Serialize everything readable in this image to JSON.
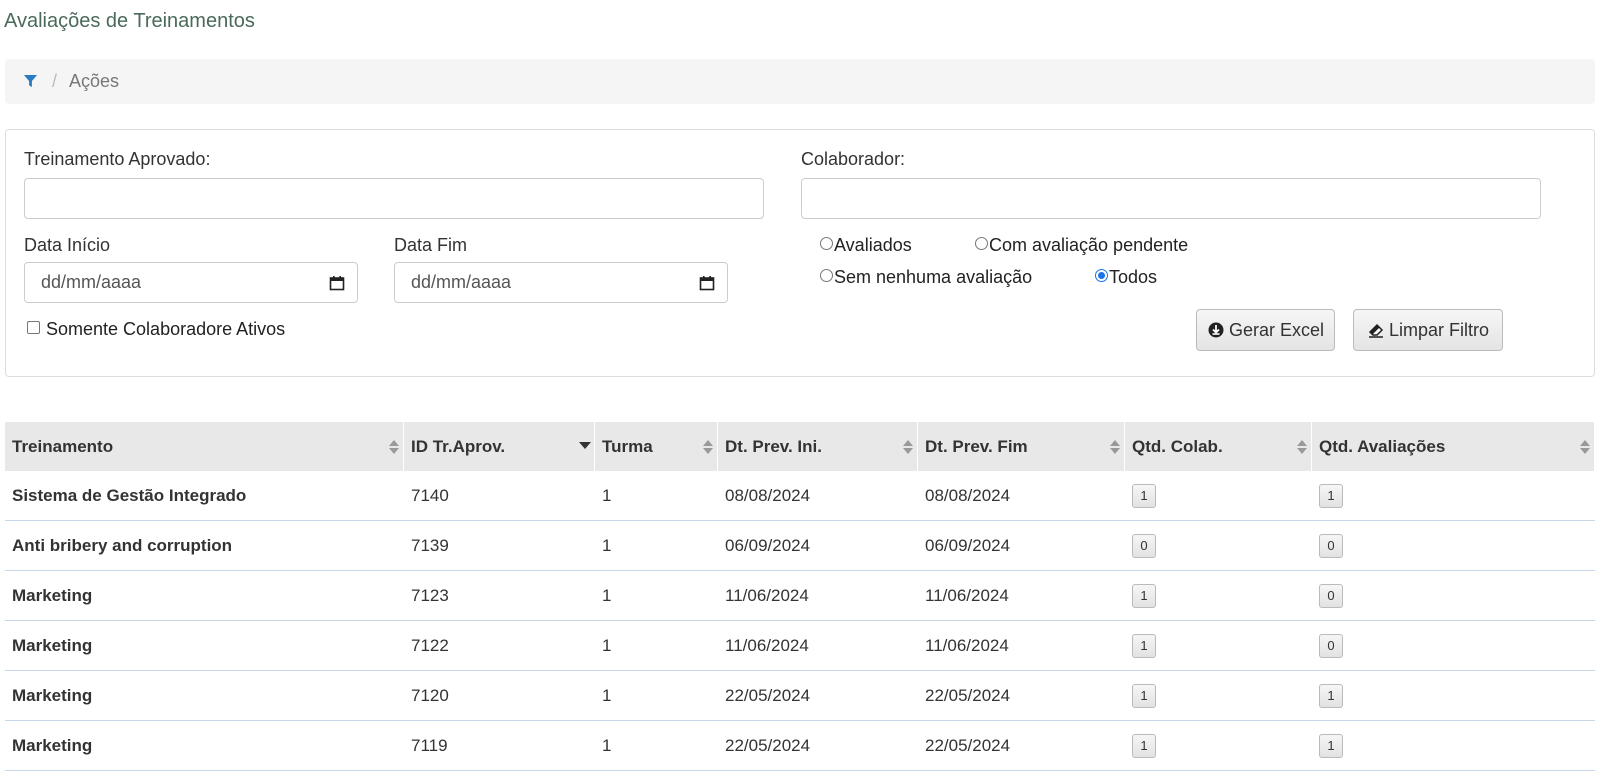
{
  "title": "Avaliações de Treinamentos",
  "breadcrumb": {
    "icon": "filter-icon",
    "separator": "/",
    "label": "Ações"
  },
  "filters": {
    "treinamento_label": "Treinamento Aprovado:",
    "treinamento_value": "",
    "colaborador_label": "Colaborador:",
    "colaborador_value": "",
    "data_inicio_label": "Data Início",
    "data_inicio_placeholder": "dd/mm/aaaa",
    "data_fim_label": "Data Fim",
    "data_fim_placeholder": "dd/mm/aaaa",
    "radios": [
      {
        "label": "Avaliados",
        "checked": false
      },
      {
        "label": "Com avaliação pendente",
        "checked": false
      },
      {
        "label": "Sem nenhuma avaliação",
        "checked": false
      },
      {
        "label": "Todos",
        "checked": true
      }
    ],
    "checkbox_label": "Somente Colaboradore Ativos",
    "checkbox_checked": false,
    "btn_excel": "Gerar Excel",
    "btn_limpar": "Limpar Filtro"
  },
  "table": {
    "columns": [
      "Treinamento",
      "ID Tr.Aprov.",
      "Turma",
      "Dt. Prev. Ini.",
      "Dt. Prev. Fim",
      "Qtd. Colab.",
      "Qtd. Avaliações"
    ],
    "sorted_column": "ID Tr.Aprov.",
    "rows": [
      {
        "treinamento": "Sistema de Gestão Integrado",
        "id": "7140",
        "turma": "1",
        "ini": "08/08/2024",
        "fim": "08/08/2024",
        "colab": "1",
        "aval": "1"
      },
      {
        "treinamento": "Anti bribery and corruption",
        "id": "7139",
        "turma": "1",
        "ini": "06/09/2024",
        "fim": "06/09/2024",
        "colab": "0",
        "aval": "0"
      },
      {
        "treinamento": "Marketing",
        "id": "7123",
        "turma": "1",
        "ini": "11/06/2024",
        "fim": "11/06/2024",
        "colab": "1",
        "aval": "0"
      },
      {
        "treinamento": "Marketing",
        "id": "7122",
        "turma": "1",
        "ini": "11/06/2024",
        "fim": "11/06/2024",
        "colab": "1",
        "aval": "0"
      },
      {
        "treinamento": "Marketing",
        "id": "7120",
        "turma": "1",
        "ini": "22/05/2024",
        "fim": "22/05/2024",
        "colab": "1",
        "aval": "1"
      },
      {
        "treinamento": "Marketing",
        "id": "7119",
        "turma": "1",
        "ini": "22/05/2024",
        "fim": "22/05/2024",
        "colab": "1",
        "aval": "1"
      }
    ]
  },
  "colors": {
    "accent": "#1a73e8",
    "title": "#4a6a5a",
    "row_border": "#c5d6e8",
    "header_bg": "#e8e8e8"
  }
}
